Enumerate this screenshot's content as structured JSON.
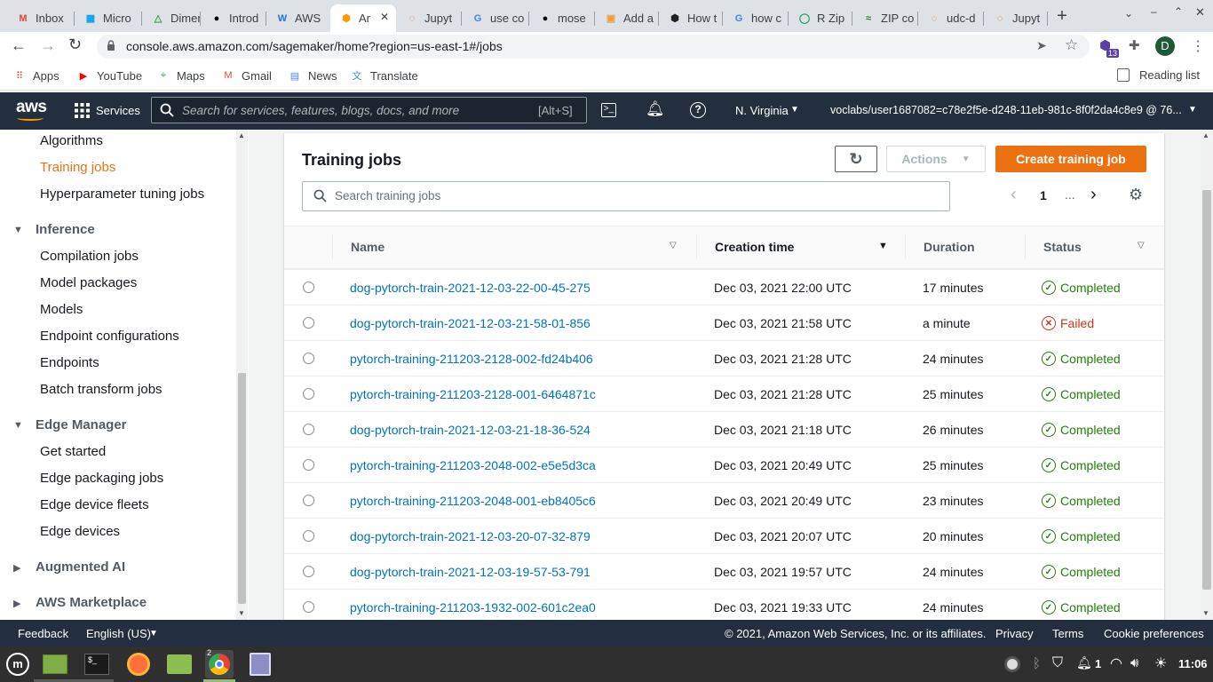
{
  "browser": {
    "tabs": [
      {
        "label": "Inbox",
        "icon": "gmail-icon",
        "color": "#ea4335",
        "glyph": "M"
      },
      {
        "label": "Micro",
        "icon": "microsoft-icon",
        "color": "#00a4ef",
        "glyph": "▦"
      },
      {
        "label": "Dimer",
        "icon": "drive-icon",
        "color": "#34a853",
        "glyph": "△"
      },
      {
        "label": "Introd",
        "icon": "video-icon",
        "color": "#000000",
        "glyph": "●"
      },
      {
        "label": "AWS",
        "icon": "aws-icon",
        "color": "#1a73e8",
        "glyph": "W"
      },
      {
        "label": "Ar",
        "icon": "sagemaker-icon",
        "color": "#ff9900",
        "glyph": "⬢"
      },
      {
        "label": "Jupyt",
        "icon": "jupyter-icon",
        "color": "#f37626",
        "glyph": "◌"
      },
      {
        "label": "use co",
        "icon": "google-icon",
        "color": "#4285f4",
        "glyph": "G"
      },
      {
        "label": "mose",
        "icon": "github-icon",
        "color": "#000000",
        "glyph": "●"
      },
      {
        "label": "Add a",
        "icon": "box-icon",
        "color": "#e8a23c",
        "glyph": "▣"
      },
      {
        "label": "How t",
        "icon": "hex-icon",
        "color": "#222222",
        "glyph": "⬢"
      },
      {
        "label": "how c",
        "icon": "google-icon",
        "color": "#4285f4",
        "glyph": "G"
      },
      {
        "label": "R Zip",
        "icon": "r-icon",
        "color": "#1a9c5b",
        "glyph": "◯"
      },
      {
        "label": "ZIP co",
        "icon": "zip-icon",
        "color": "#2e7d32",
        "glyph": "≈"
      },
      {
        "label": "udc-d",
        "icon": "jupyter-icon",
        "color": "#f37626",
        "glyph": "◌"
      },
      {
        "label": "Jupyt",
        "icon": "jupyter-icon",
        "color": "#f37626",
        "glyph": "◌"
      }
    ],
    "url": "console.aws.amazon.com/sagemaker/home?region=us-east-1#/jobs",
    "profile_initial": "D",
    "extension_badge": "13",
    "bookmarks": [
      {
        "label": "Apps",
        "icon": "apps-icon",
        "color": "#ea4335",
        "glyph": "⠿"
      },
      {
        "label": "YouTube",
        "icon": "youtube-icon",
        "color": "#ff0000",
        "glyph": "▶"
      },
      {
        "label": "Maps",
        "icon": "maps-icon",
        "color": "#34a853",
        "glyph": "⌖"
      },
      {
        "label": "Gmail",
        "icon": "gmail-icon",
        "color": "#ea4335",
        "glyph": "M"
      },
      {
        "label": "News",
        "icon": "news-icon",
        "color": "#4285f4",
        "glyph": "▤"
      },
      {
        "label": "Translate",
        "icon": "translate-icon",
        "color": "#4285f4",
        "glyph": "文"
      }
    ],
    "reading_list": "Reading list"
  },
  "aws": {
    "logo": "aws",
    "services": "Services",
    "search_placeholder": "Search for services, features, blogs, docs, and more",
    "search_shortcut": "[Alt+S]",
    "region": "N. Virginia",
    "account": "voclabs/user1687082=c78e2f5e-d248-11eb-981c-8f0f2da4c8e9 @ 76..."
  },
  "sidebar": {
    "items_top": [
      "Algorithms",
      "Training jobs",
      "Hyperparameter tuning jobs"
    ],
    "active": "Training jobs",
    "inference_title": "Inference",
    "inference_items": [
      "Compilation jobs",
      "Model packages",
      "Models",
      "Endpoint configurations",
      "Endpoints",
      "Batch transform jobs"
    ],
    "edge_title": "Edge Manager",
    "edge_items": [
      "Get started",
      "Edge packaging jobs",
      "Edge device fleets",
      "Edge devices"
    ],
    "augmented": "Augmented AI",
    "marketplace": "AWS Marketplace"
  },
  "main": {
    "title": "Training jobs",
    "actions_label": "Actions",
    "create_label": "Create training job",
    "search_placeholder": "Search training jobs",
    "page": "1",
    "ellipsis": "...",
    "columns": {
      "name": "Name",
      "creation": "Creation time",
      "duration": "Duration",
      "status": "Status"
    },
    "rows": [
      {
        "name": "dog-pytorch-train-2021-12-03-22-00-45-275",
        "time": "Dec 03, 2021 22:00 UTC",
        "duration": "17 minutes",
        "status": "Completed"
      },
      {
        "name": "dog-pytorch-train-2021-12-03-21-58-01-856",
        "time": "Dec 03, 2021 21:58 UTC",
        "duration": "a minute",
        "status": "Failed"
      },
      {
        "name": "pytorch-training-211203-2128-002-fd24b406",
        "time": "Dec 03, 2021 21:28 UTC",
        "duration": "24 minutes",
        "status": "Completed"
      },
      {
        "name": "pytorch-training-211203-2128-001-6464871c",
        "time": "Dec 03, 2021 21:28 UTC",
        "duration": "25 minutes",
        "status": "Completed"
      },
      {
        "name": "dog-pytorch-train-2021-12-03-21-18-36-524",
        "time": "Dec 03, 2021 21:18 UTC",
        "duration": "26 minutes",
        "status": "Completed"
      },
      {
        "name": "pytorch-training-211203-2048-002-e5e5d3ca",
        "time": "Dec 03, 2021 20:49 UTC",
        "duration": "25 minutes",
        "status": "Completed"
      },
      {
        "name": "pytorch-training-211203-2048-001-eb8405c6",
        "time": "Dec 03, 2021 20:49 UTC",
        "duration": "23 minutes",
        "status": "Completed"
      },
      {
        "name": "dog-pytorch-train-2021-12-03-20-07-32-879",
        "time": "Dec 03, 2021 20:07 UTC",
        "duration": "20 minutes",
        "status": "Completed"
      },
      {
        "name": "dog-pytorch-train-2021-12-03-19-57-53-791",
        "time": "Dec 03, 2021 19:57 UTC",
        "duration": "24 minutes",
        "status": "Completed"
      },
      {
        "name": "pytorch-training-211203-1932-002-601c2ea0",
        "time": "Dec 03, 2021 19:33 UTC",
        "duration": "24 minutes",
        "status": "Completed"
      }
    ]
  },
  "footer": {
    "feedback": "Feedback",
    "language": "English (US)",
    "copyright": "© 2021, Amazon Web Services, Inc. or its affiliates.",
    "privacy": "Privacy",
    "terms": "Terms",
    "cookies": "Cookie preferences"
  },
  "taskbar": {
    "workspace_badge": "2",
    "notifications": "1",
    "clock": "11:06"
  }
}
